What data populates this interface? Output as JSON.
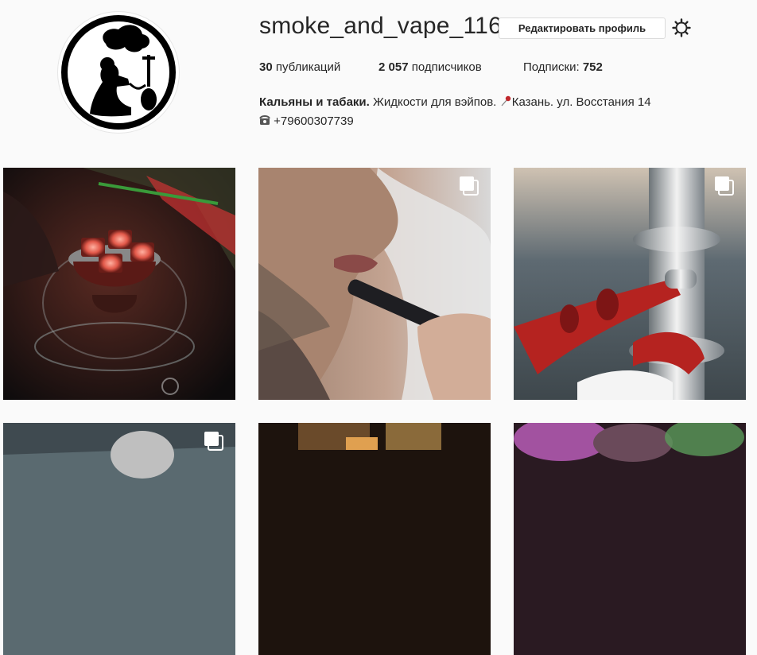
{
  "profile": {
    "username": "smoke_and_vape_116",
    "edit_button": "Редактировать профиль",
    "settings_icon": "gear-icon",
    "stats": {
      "posts_count": "30",
      "posts_label": "публикаций",
      "followers_count": "2 057",
      "followers_label": "подписчиков",
      "following_label": "Подписки:",
      "following_count": "752"
    },
    "bio": {
      "name": "Кальяны и табаки.",
      "line1": "Жидкости для вэйпов.",
      "pin_icon": "pushpin-icon",
      "address": "Казань. ул. Восстания 14",
      "phone_icon": "telephone-icon",
      "phone": "+79600307739"
    }
  },
  "grid": {
    "posts": [
      {
        "subject": "hookah-coals",
        "multi": false
      },
      {
        "subject": "man-vaping",
        "multi": true
      },
      {
        "subject": "hookah-stem",
        "multi": true
      },
      {
        "subject": "person-smoking",
        "multi": true
      },
      {
        "subject": "bar-interior",
        "multi": false
      },
      {
        "subject": "colored-smoke",
        "multi": false
      }
    ]
  }
}
